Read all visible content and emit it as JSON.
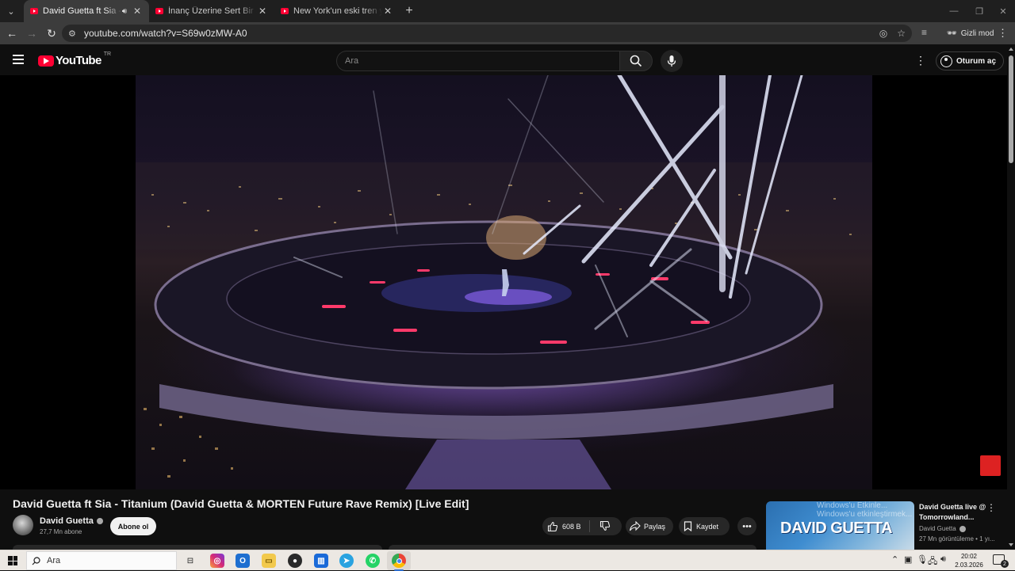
{
  "browser": {
    "tabs": [
      {
        "title": "David Guetta ft Sia - Titanium",
        "active": true,
        "audio": true
      },
      {
        "title": "İnanç Üzerine Sert Bir Sohbet -",
        "active": false
      },
      {
        "title": "New York'un eski tren yolunda",
        "active": false
      }
    ],
    "url": "youtube.com/watch?v=S69w0zMW-A0",
    "incognito_label": "Gizli mod"
  },
  "youtube": {
    "logo_text": "YouTube",
    "country_code": "TR",
    "search_placeholder": "Ara",
    "sign_in_label": "Oturum aç"
  },
  "video": {
    "title": "David Guetta ft Sia - Titanium (David Guetta & MORTEN Future Rave Remix) [Live Edit]",
    "channel_name": "David Guetta",
    "subscribers": "27,7 Mn abone",
    "subscribe_label": "Abone ol",
    "likes": "608 B",
    "share_label": "Paylaş",
    "save_label": "Kaydet"
  },
  "recommendation": {
    "title": "David Guetta live @ Tomorrowland...",
    "channel": "David Guetta",
    "meta": "27 Mn görüntüleme • 1 yı...",
    "thumb_text": "DAVID GUETTA",
    "watermark_line1": "Windows'u Etkinle...",
    "watermark_line2": "Windows'u etkinleştirmek..."
  },
  "taskbar": {
    "search_placeholder": "Ara",
    "time": "20:02",
    "date": "2.03.2026",
    "notification_count": "2"
  },
  "colors": {
    "youtube_red": "#ff0033",
    "page_bg": "#0f0f0f",
    "taskbar_bg": "#ece8e3"
  }
}
